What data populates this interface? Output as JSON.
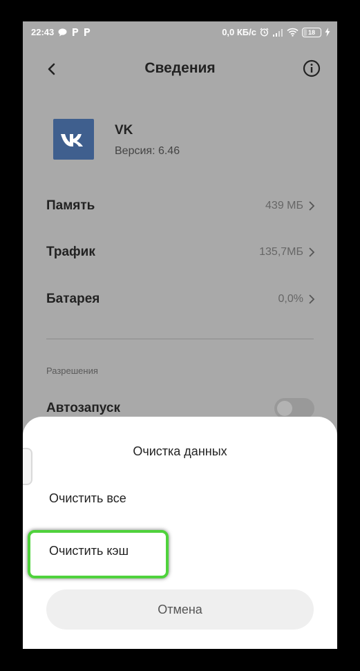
{
  "status_bar": {
    "time": "22:43",
    "net_speed": "0,0 КБ/с",
    "battery": "18"
  },
  "header": {
    "title": "Сведения"
  },
  "app": {
    "name": "VK",
    "version": "Версия: 6.46",
    "icon_letters": "VK",
    "brand_color": "#3f5f8e"
  },
  "rows": [
    {
      "label": "Память",
      "value": "439 МБ"
    },
    {
      "label": "Трафик",
      "value": "135,7МБ"
    },
    {
      "label": "Батарея",
      "value": "0,0%"
    }
  ],
  "permissions": {
    "section_label": "Разрешения",
    "autostart_label": "Автозапуск",
    "autostart_on": false
  },
  "dialog": {
    "title": "Очистка данных",
    "clear_all": "Очистить все",
    "clear_cache": "Очистить кэш",
    "cancel": "Отмена"
  },
  "colors": {
    "highlight": "#4fd23c",
    "overlay": "#a9a9a9"
  },
  "icons": [
    "back-arrow-icon",
    "info-icon",
    "chevron-right-icon",
    "vk-logo-icon",
    "chat-bubble-icon",
    "p-icon",
    "alarm-icon",
    "signal-icon",
    "wifi-icon",
    "battery-icon",
    "charging-icon"
  ]
}
